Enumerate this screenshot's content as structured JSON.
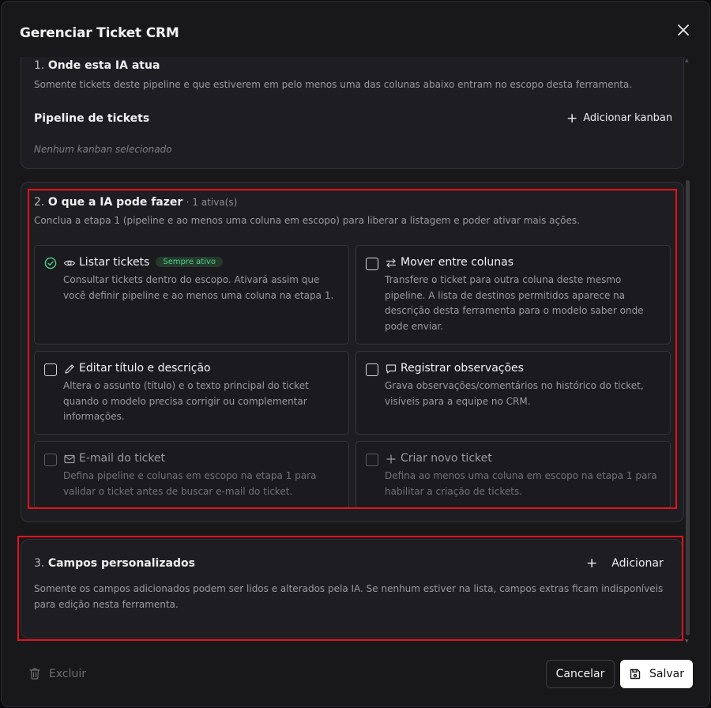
{
  "dialog": {
    "title": "Gerenciar Ticket CRM"
  },
  "section1": {
    "number": "1.",
    "title": "Onde esta IA atua",
    "description": "Somente tickets deste pipeline e que estiverem em pelo menos uma das colunas abaixo entram no escopo desta ferramenta.",
    "pipeline_label": "Pipeline de tickets",
    "add_kanban_label": "Adicionar kanban",
    "empty_text": "Nenhum kanban selecionado"
  },
  "section2": {
    "number": "2.",
    "title": "O que a IA pode fazer",
    "active_count": "· 1 ativa(s)",
    "description": "Conclua a etapa 1 (pipeline e ao menos uma coluna em escopo) para liberar a listagem e poder ativar mais ações.",
    "actions": [
      {
        "title": "Listar tickets",
        "badge": "Sempre ativo",
        "icon": "eye-icon",
        "checked": true,
        "description": "Consultar tickets dentro do escopo. Ativará assim que você definir pipeline e ao menos uma coluna na etapa 1."
      },
      {
        "title": "Mover entre colunas",
        "icon": "arrows-exchange-icon",
        "checked": false,
        "description": "Transfere o ticket para outra coluna deste mesmo pipeline. A lista de destinos permitidos aparece na descrição desta ferramenta para o modelo saber onde pode enviar."
      },
      {
        "title": "Editar título e descrição",
        "icon": "pencil-icon",
        "checked": false,
        "description": "Altera o assunto (título) e o texto principal do ticket quando o modelo precisa corrigir ou complementar informações."
      },
      {
        "title": "Registrar observações",
        "icon": "message-icon",
        "checked": false,
        "description": "Grava observações/comentários no histórico do ticket, visíveis para a equipe no CRM."
      },
      {
        "title": "E-mail do ticket",
        "icon": "mail-icon",
        "checked": false,
        "description": "Defina pipeline e colunas em escopo na etapa 1 para validar o ticket antes de buscar e-mail do ticket."
      },
      {
        "title": "Criar novo ticket",
        "icon": "plus-icon",
        "checked": false,
        "description": "Defina ao menos uma coluna em escopo na etapa 1 para habilitar a criação de tickets."
      }
    ]
  },
  "section3": {
    "number": "3.",
    "title": "Campos personalizados",
    "add_label": "Adicionar",
    "description": "Somente os campos adicionados podem ser lidos e alterados pela IA. Se nenhum estiver na lista, campos extras ficam indisponíveis para edição nesta ferramenta."
  },
  "footer": {
    "delete_label": "Excluir",
    "cancel_label": "Cancelar",
    "save_label": "Salvar"
  },
  "colors": {
    "accent_green": "#4fd18b",
    "highlight_red": "#e3121d"
  }
}
